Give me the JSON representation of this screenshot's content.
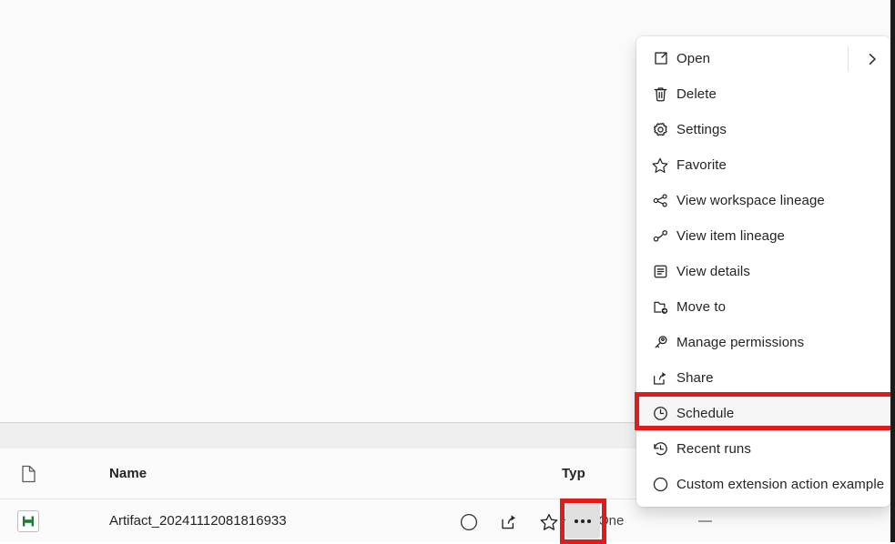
{
  "window": {
    "background_color": "#fafafa",
    "edge_color": "#1b1b1b"
  },
  "list": {
    "columns": [
      {
        "key": "icon",
        "label": "",
        "icon": "document-icon"
      },
      {
        "key": "name",
        "label": "Name"
      },
      {
        "key": "type",
        "label": "Typ"
      },
      {
        "key": "owner",
        "label": ""
      },
      {
        "key": "refresh",
        "label": ""
      }
    ],
    "rows": [
      {
        "icon": "artifact-green-icon",
        "name": "Artifact_20241112081816933",
        "type": "HomeOne",
        "refreshed": "—",
        "actions": [
          {
            "name": "circle-icon",
            "glyph": "circle"
          },
          {
            "name": "share-icon",
            "glyph": "share"
          },
          {
            "name": "favorite-star-icon",
            "glyph": "star"
          },
          {
            "name": "more-actions-icon",
            "glyph": "ellipsis"
          }
        ]
      }
    ]
  },
  "context_menu": {
    "items": [
      {
        "id": "open",
        "label": "Open",
        "icon": "open-external-icon",
        "has_submenu": true,
        "submenu_icon": "chevron-right-icon"
      },
      {
        "id": "delete",
        "label": "Delete",
        "icon": "trash-icon",
        "has_submenu": false
      },
      {
        "id": "settings",
        "label": "Settings",
        "icon": "gear-icon",
        "has_submenu": false
      },
      {
        "id": "favorite",
        "label": "Favorite",
        "icon": "star-icon",
        "has_submenu": false
      },
      {
        "id": "view-workspace-lineage",
        "label": "View workspace lineage",
        "icon": "workspace-lineage-icon",
        "has_submenu": false
      },
      {
        "id": "view-item-lineage",
        "label": "View item lineage",
        "icon": "item-lineage-icon",
        "has_submenu": false
      },
      {
        "id": "view-details",
        "label": "View details",
        "icon": "details-panel-icon",
        "has_submenu": false
      },
      {
        "id": "move-to",
        "label": "Move to",
        "icon": "folder-move-icon",
        "has_submenu": false
      },
      {
        "id": "manage-permissions",
        "label": "Manage permissions",
        "icon": "key-icon",
        "has_submenu": false
      },
      {
        "id": "share",
        "label": "Share",
        "icon": "share-icon",
        "has_submenu": false
      },
      {
        "id": "schedule",
        "label": "Schedule",
        "icon": "clock-icon",
        "has_submenu": false,
        "highlighted": true
      },
      {
        "id": "recent-runs",
        "label": "Recent runs",
        "icon": "history-icon",
        "has_submenu": false
      },
      {
        "id": "custom-extension-action-example",
        "label": "Custom extension action example",
        "icon": "circle-icon",
        "has_submenu": false
      }
    ]
  },
  "annotations": {
    "color": "#e01b1b",
    "boxes": [
      {
        "target": "schedule-menu-item"
      },
      {
        "target": "more-actions-button"
      }
    ]
  }
}
